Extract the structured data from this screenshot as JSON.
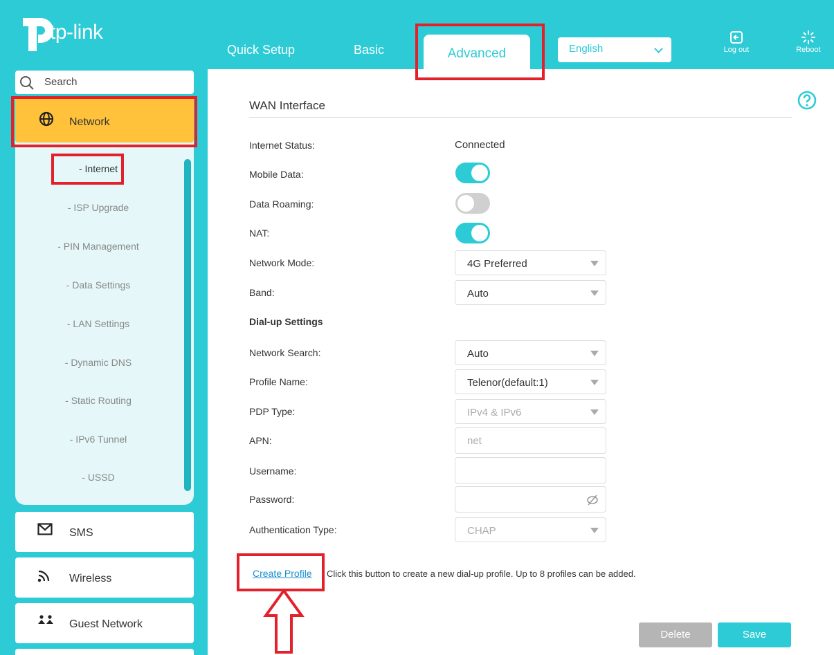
{
  "brand": {
    "name": "tp-link"
  },
  "header": {
    "tabs": [
      "Quick Setup",
      "Basic",
      "Advanced"
    ],
    "language": "English",
    "logout_label": "Log out",
    "reboot_label": "Reboot"
  },
  "sidebar": {
    "search_label": "Search",
    "network_label": "Network",
    "sub_items": [
      "- Internet",
      "- ISP Upgrade",
      "- PIN Management",
      "- Data Settings",
      "- LAN Settings",
      "- Dynamic DNS",
      "- Static Routing",
      "- IPv6 Tunnel",
      "- USSD"
    ],
    "cards": [
      "SMS",
      "Wireless",
      "Guest Network"
    ]
  },
  "main": {
    "section_title": "WAN Interface",
    "internet_status_label": "Internet Status:",
    "internet_status_value": "Connected",
    "mobile_data_label": "Mobile Data:",
    "mobile_data_on": true,
    "data_roaming_label": "Data Roaming:",
    "data_roaming_on": false,
    "nat_label": "NAT:",
    "nat_on": true,
    "network_mode_label": "Network Mode:",
    "network_mode_value": "4G Preferred",
    "band_label": "Band:",
    "band_value": "Auto",
    "dialup_heading": "Dial-up Settings",
    "network_search_label": "Network Search:",
    "network_search_value": "Auto",
    "profile_name_label": "Profile Name:",
    "profile_name_value": "Telenor(default:1)",
    "pdp_type_label": "PDP Type:",
    "pdp_type_value": "IPv4 & IPv6",
    "apn_label": "APN:",
    "apn_value": "net",
    "username_label": "Username:",
    "username_value": "",
    "password_label": "Password:",
    "password_value": "",
    "auth_type_label": "Authentication Type:",
    "auth_type_value": "CHAP",
    "create_profile_label": "Create Profile",
    "create_profile_hint": "Click this button to create a new dial-up profile. Up to 8 profiles can be added.",
    "delete_label": "Delete",
    "save_label": "Save"
  },
  "colors": {
    "accent": "#2ccbd6",
    "highlight": "#ffc23a",
    "annotation": "#e3212b"
  }
}
